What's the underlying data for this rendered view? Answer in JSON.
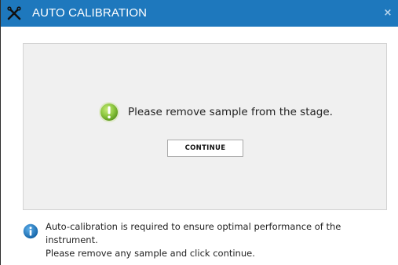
{
  "window": {
    "title": "AUTO CALIBRATION",
    "close_label": "×",
    "title_icon": "tools-icon",
    "titlebar_color": "#1e78bd"
  },
  "dialog": {
    "message": "Please remove sample from the stage.",
    "message_icon": "alert-icon",
    "message_icon_color": "#8cc63f",
    "continue_label": "CONTINUE"
  },
  "info": {
    "icon": "info-icon",
    "icon_color": "#1e78bd",
    "line1": "Auto-calibration is required to ensure optimal performance of the instrument.",
    "line2": "Please remove any sample and click continue."
  }
}
